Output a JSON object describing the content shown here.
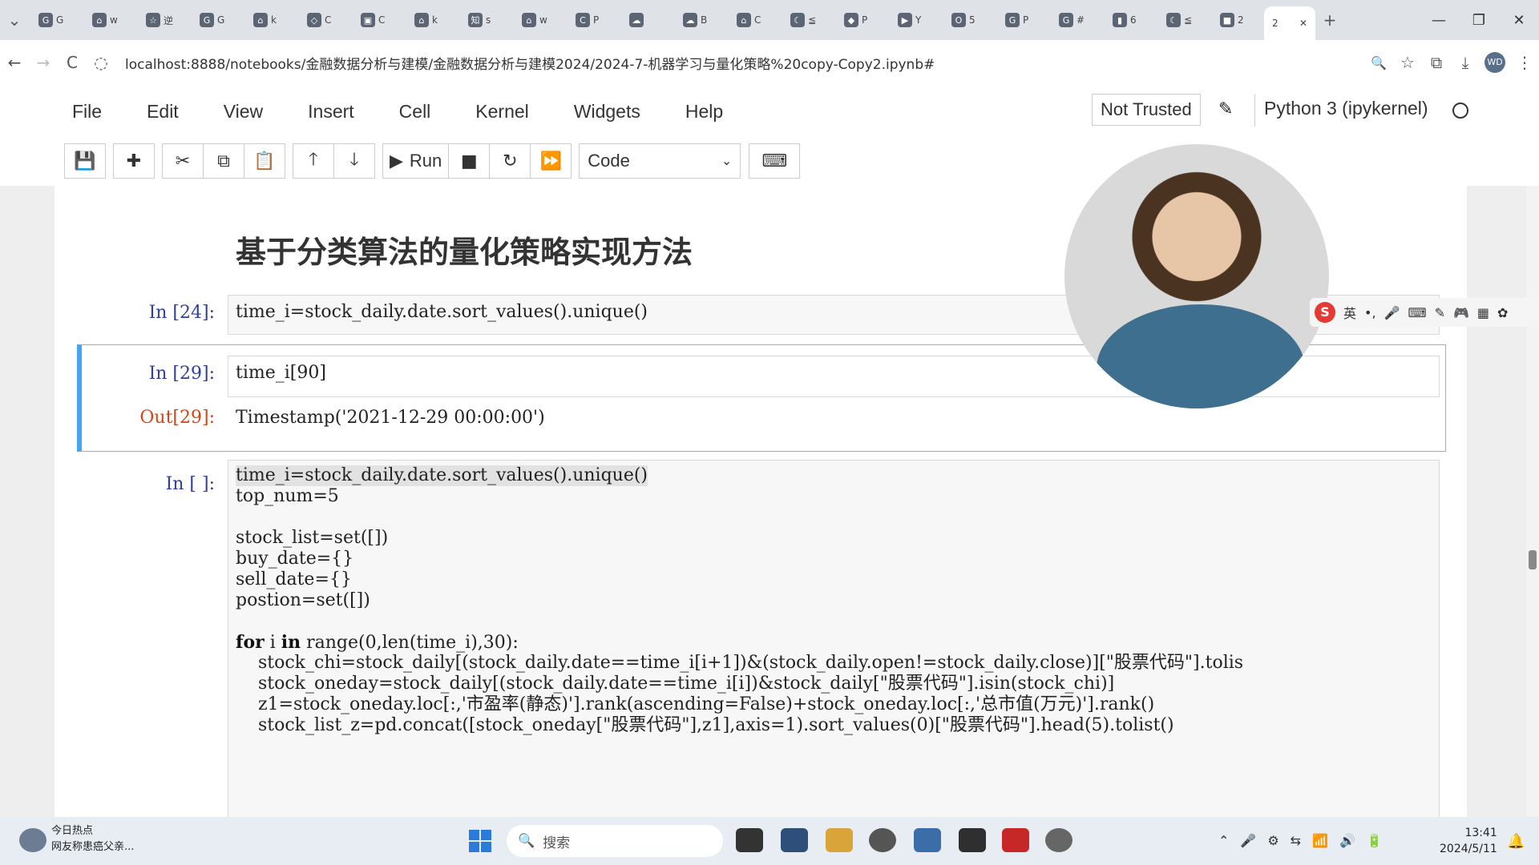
{
  "tabs": [
    {
      "icon": "G",
      "label": "G"
    },
    {
      "icon": "⌂",
      "label": "w"
    },
    {
      "icon": "☆",
      "label": "逆"
    },
    {
      "icon": "G",
      "label": "G"
    },
    {
      "icon": "⌂",
      "label": "k"
    },
    {
      "icon": "◇",
      "label": "C"
    },
    {
      "icon": "▣",
      "label": "C"
    },
    {
      "icon": "⌂",
      "label": "k"
    },
    {
      "icon": "知",
      "label": "s"
    },
    {
      "icon": "⌂",
      "label": "w"
    },
    {
      "icon": "C",
      "label": "P"
    },
    {
      "icon": "☁",
      "label": ""
    },
    {
      "icon": "☁",
      "label": "B"
    },
    {
      "icon": "⌂",
      "label": "C"
    },
    {
      "icon": "☾",
      "label": "≦"
    },
    {
      "icon": "◆",
      "label": "P"
    },
    {
      "icon": "▶",
      "label": "Y"
    },
    {
      "icon": "O",
      "label": "5"
    },
    {
      "icon": "G",
      "label": "P"
    },
    {
      "icon": "G",
      "label": "#"
    },
    {
      "icon": "▮",
      "label": "6"
    },
    {
      "icon": "☾",
      "label": "≦"
    },
    {
      "icon": "■",
      "label": "2"
    }
  ],
  "active_tab": {
    "label": "2",
    "close": "✕"
  },
  "new_tab": "+",
  "window": {
    "min": "—",
    "max": "❐",
    "close": "✕"
  },
  "address": {
    "url": "localhost:8888/notebooks/金融数据分析与建模/金融数据分析与建模2024/2024-7-机器学习与量化策略%20copy-Copy2.ipynb#",
    "back": "←",
    "forward": "→",
    "reload": "C"
  },
  "browser_actions": {
    "zoom": "🔍",
    "star": "☆",
    "ext": "⧉",
    "download": "⤓",
    "profile": "WD",
    "more": "⋮"
  },
  "menu": [
    "File",
    "Edit",
    "View",
    "Insert",
    "Cell",
    "Kernel",
    "Widgets",
    "Help"
  ],
  "trust": "Not Trusted",
  "kernel_name": "Python 3 (ipykernel)",
  "toolbar": {
    "run": "Run",
    "cell_type": "Code"
  },
  "notebook": {
    "heading": "基于分类算法的量化策略实现方法",
    "cell1": {
      "prompt": "In  [24]:",
      "code": "time_i=stock_daily.date.sort_values().unique()"
    },
    "cell2": {
      "prompt": "In  [29]:",
      "code": "time_i[90]",
      "out_prompt": "Out[29]:",
      "output": "Timestamp('2021-12-29 00:00:00')"
    },
    "cell3": {
      "prompt": "In  [  ]:",
      "lines": [
        "time_i=stock_daily.date.sort_values().unique()",
        "top_num=5",
        "",
        "stock_list=set([])",
        "buy_date={}",
        "sell_date={}",
        "postion=set([])",
        "",
        "for i in range(0,len(time_i),30):",
        "    stock_chi=stock_daily[(stock_daily.date==time_i[i+1])&(stock_daily.open!=stock_daily.close)][\"股票代码\"].tolis",
        "    stock_oneday=stock_daily[(stock_daily.date==time_i[i])&stock_daily[\"股票代码\"].isin(stock_chi)]",
        "    z1=stock_oneday.loc[:,'市盈率(静态)'].rank(ascending=False)+stock_oneday.loc[:,'总市值(万元)'].rank()",
        "    stock_list_z=pd.concat([stock_oneday[\"股票代码\"],z1],axis=1).sort_values(0)[\"股票代码\"].head(5).tolist()"
      ]
    }
  },
  "ime": {
    "logo": "S",
    "lang": "英",
    "items": [
      "•,",
      "🎤",
      "⌨",
      "✎",
      "🎮",
      "▦",
      "✿"
    ]
  },
  "taskbar": {
    "news_title": "今日热点",
    "news_sub": "网友称患癌父亲...",
    "search_placeholder": "搜索",
    "time": "13:41",
    "date": "2024/5/11"
  }
}
